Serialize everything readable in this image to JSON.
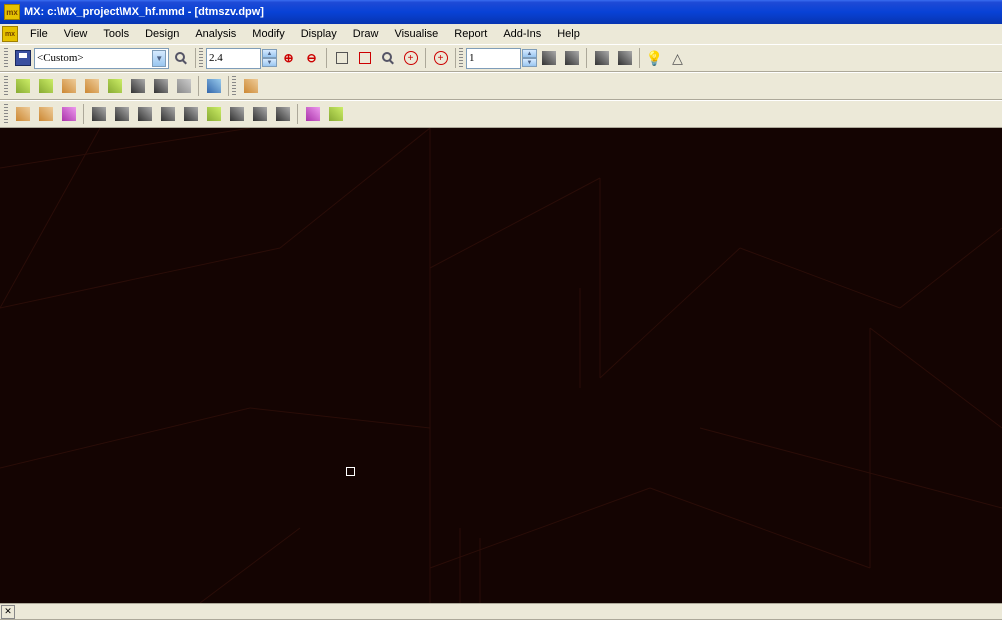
{
  "title": "MX: c:\\MX_project\\MX_hf.mmd - [dtmszv.dpw]",
  "menu": [
    "File",
    "View",
    "Tools",
    "Design",
    "Analysis",
    "Modify",
    "Display",
    "Draw",
    "Visualise",
    "Report",
    "Add-Ins",
    "Help"
  ],
  "toolbar1": {
    "layer_combo": "<Custom>",
    "zoom_value": "2.4",
    "scale_value": "1"
  },
  "icons": {
    "save": "save-icon",
    "mag": "magnifier-icon",
    "zin": "zoom-in-icon",
    "zout": "zoom-out-icon",
    "zwin": "zoom-window-icon",
    "zext": "zoom-extents-icon",
    "zprev": "zoom-previous-icon",
    "pan": "pan-icon",
    "target": "center-icon",
    "refresh": "refresh-icon",
    "view3d": "3d-view-icon",
    "cube": "cube-icon",
    "layers": "layers-icon",
    "bulb": "lightbulb-icon",
    "warn": "warning-icon"
  }
}
